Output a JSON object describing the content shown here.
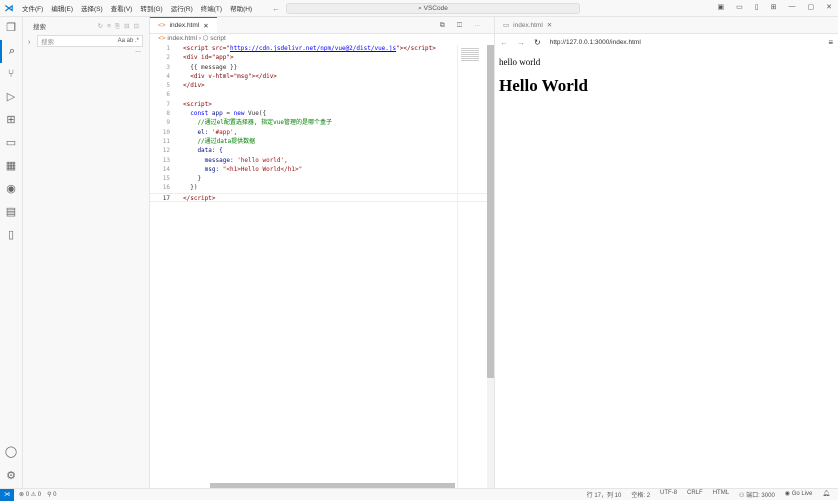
{
  "titlebar": {
    "menus": [
      "文件(F)",
      "编辑(E)",
      "选择(S)",
      "查看(V)",
      "转到(G)",
      "运行(R)",
      "终端(T)",
      "帮助(H)"
    ],
    "command_center": "VSCode"
  },
  "sidebar": {
    "title": "搜索",
    "search_placeholder": "搜索",
    "search_options": "Aa ab .*",
    "more": "..."
  },
  "editor": {
    "tab": "index.html",
    "breadcrumb": [
      "index.html",
      "script"
    ],
    "lines": [
      "1",
      "2",
      "3",
      "4",
      "5",
      "6",
      "7",
      "8",
      "9",
      "10",
      "11",
      "12",
      "13",
      "14",
      "15",
      "16",
      "17"
    ],
    "code": {
      "l1a": "<script src=\"",
      "l1u": "https://cdn.jsdelivr.net/npm/vue@2/dist/vue.js",
      "l1b": "\"></script>",
      "l2": "<div id=\"app\">",
      "l3": "  {{ message }}",
      "l4": "  <div v-html=\"msg\"></div>",
      "l5": "</div>",
      "l7": "<script>",
      "l8a": "  const ",
      "l8b": "app",
      "l8c": " = ",
      "l8d": "new",
      "l8e": " Vue({",
      "l9": "    //通过el配置选择器, 指定vue管理的是哪个盒子",
      "l10a": "    el: ",
      "l10b": "'#app'",
      "l10c": ",",
      "l11": "    //通过data提供数据",
      "l12": "    data: {",
      "l13a": "      message: ",
      "l13b": "'hello world'",
      "l13c": ",",
      "l14a": "      msg: ",
      "l14b": "\"<h1>Hello World</h1>\"",
      "l15": "    }",
      "l16": "  })",
      "l17": "</script>"
    }
  },
  "preview": {
    "tab": "index.html",
    "url": "http://127.0.0.1:3000/index.html",
    "text": "hello world",
    "heading": "Hello World"
  },
  "status": {
    "errors": "0",
    "warnings": "0",
    "ports": "0",
    "position": "行 17，列 10",
    "spaces": "空格: 2",
    "encoding": "UTF-8",
    "eol": "CRLF",
    "language": "HTML",
    "port": "端口: 3000",
    "golive": "Go Live"
  }
}
